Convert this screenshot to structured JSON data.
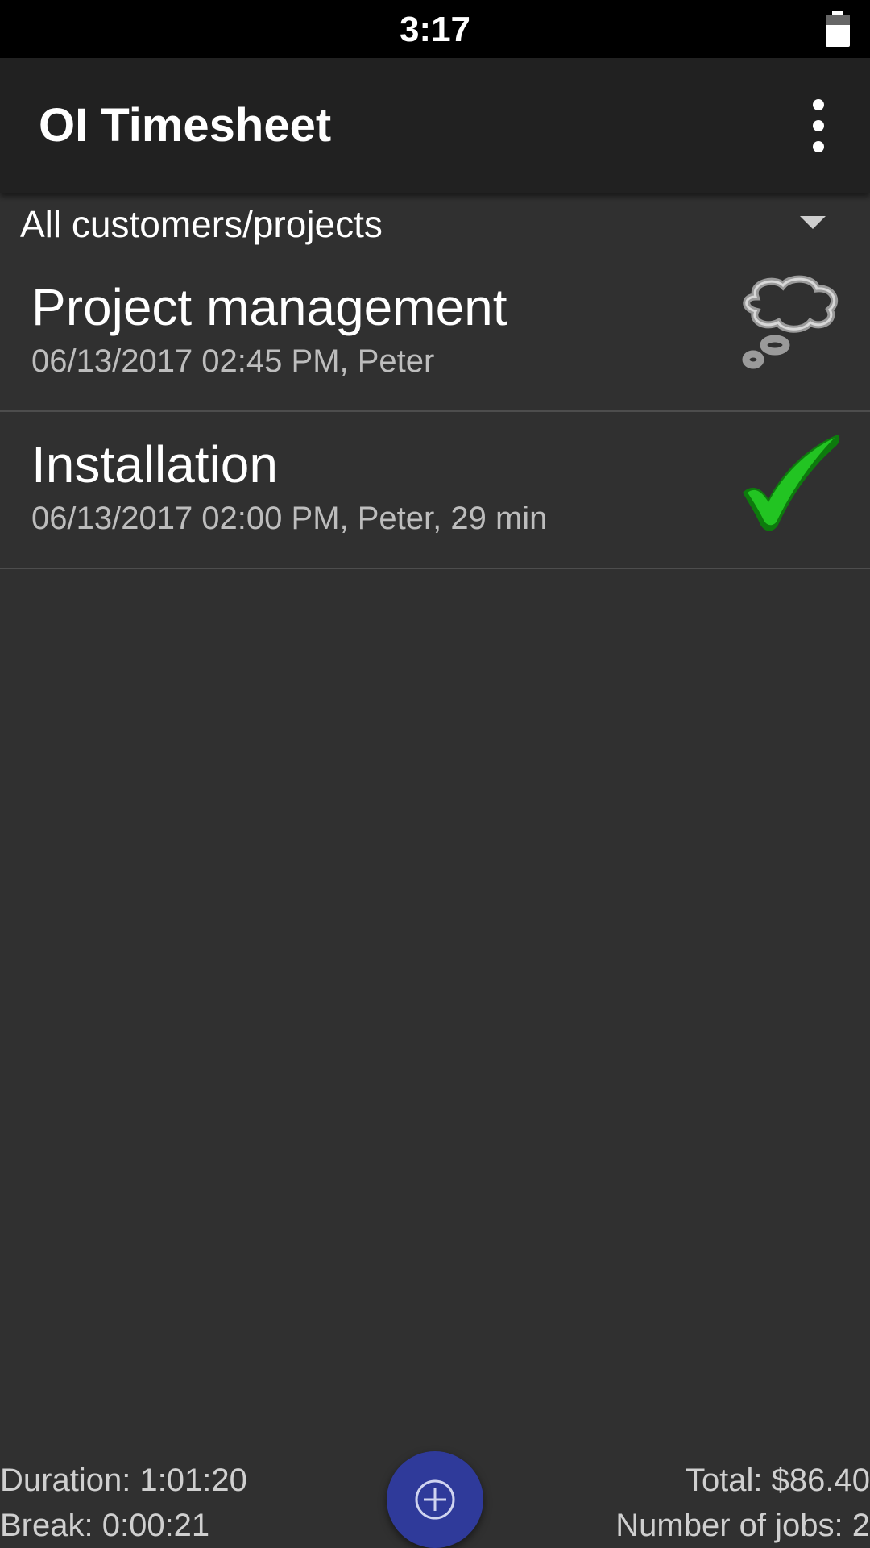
{
  "status_bar": {
    "time": "3:17",
    "battery_icon": "battery-icon"
  },
  "app_bar": {
    "title": "OI Timesheet",
    "menu_icon": "overflow-menu-icon"
  },
  "filter": {
    "selected": "All customers/projects",
    "icon": "dropdown-arrow-icon"
  },
  "jobs": [
    {
      "title": "Project management",
      "subtitle": "06/13/2017 02:45 PM, Peter",
      "status_icon": "thought-bubble-icon"
    },
    {
      "title": "Installation",
      "subtitle": "06/13/2017 02:00 PM, Peter, 29 min",
      "status_icon": "checkmark-icon"
    }
  ],
  "footer": {
    "duration": "Duration: 1:01:20",
    "break": "Break: 0:00:21",
    "total": "Total: $86.40",
    "jobs_count": "Number of jobs: 2",
    "fab_icon": "add-circle-icon"
  },
  "colors": {
    "background": "#303030",
    "app_bar": "#212121",
    "fab": "#2f3a9a",
    "check_green": "#22c422"
  }
}
